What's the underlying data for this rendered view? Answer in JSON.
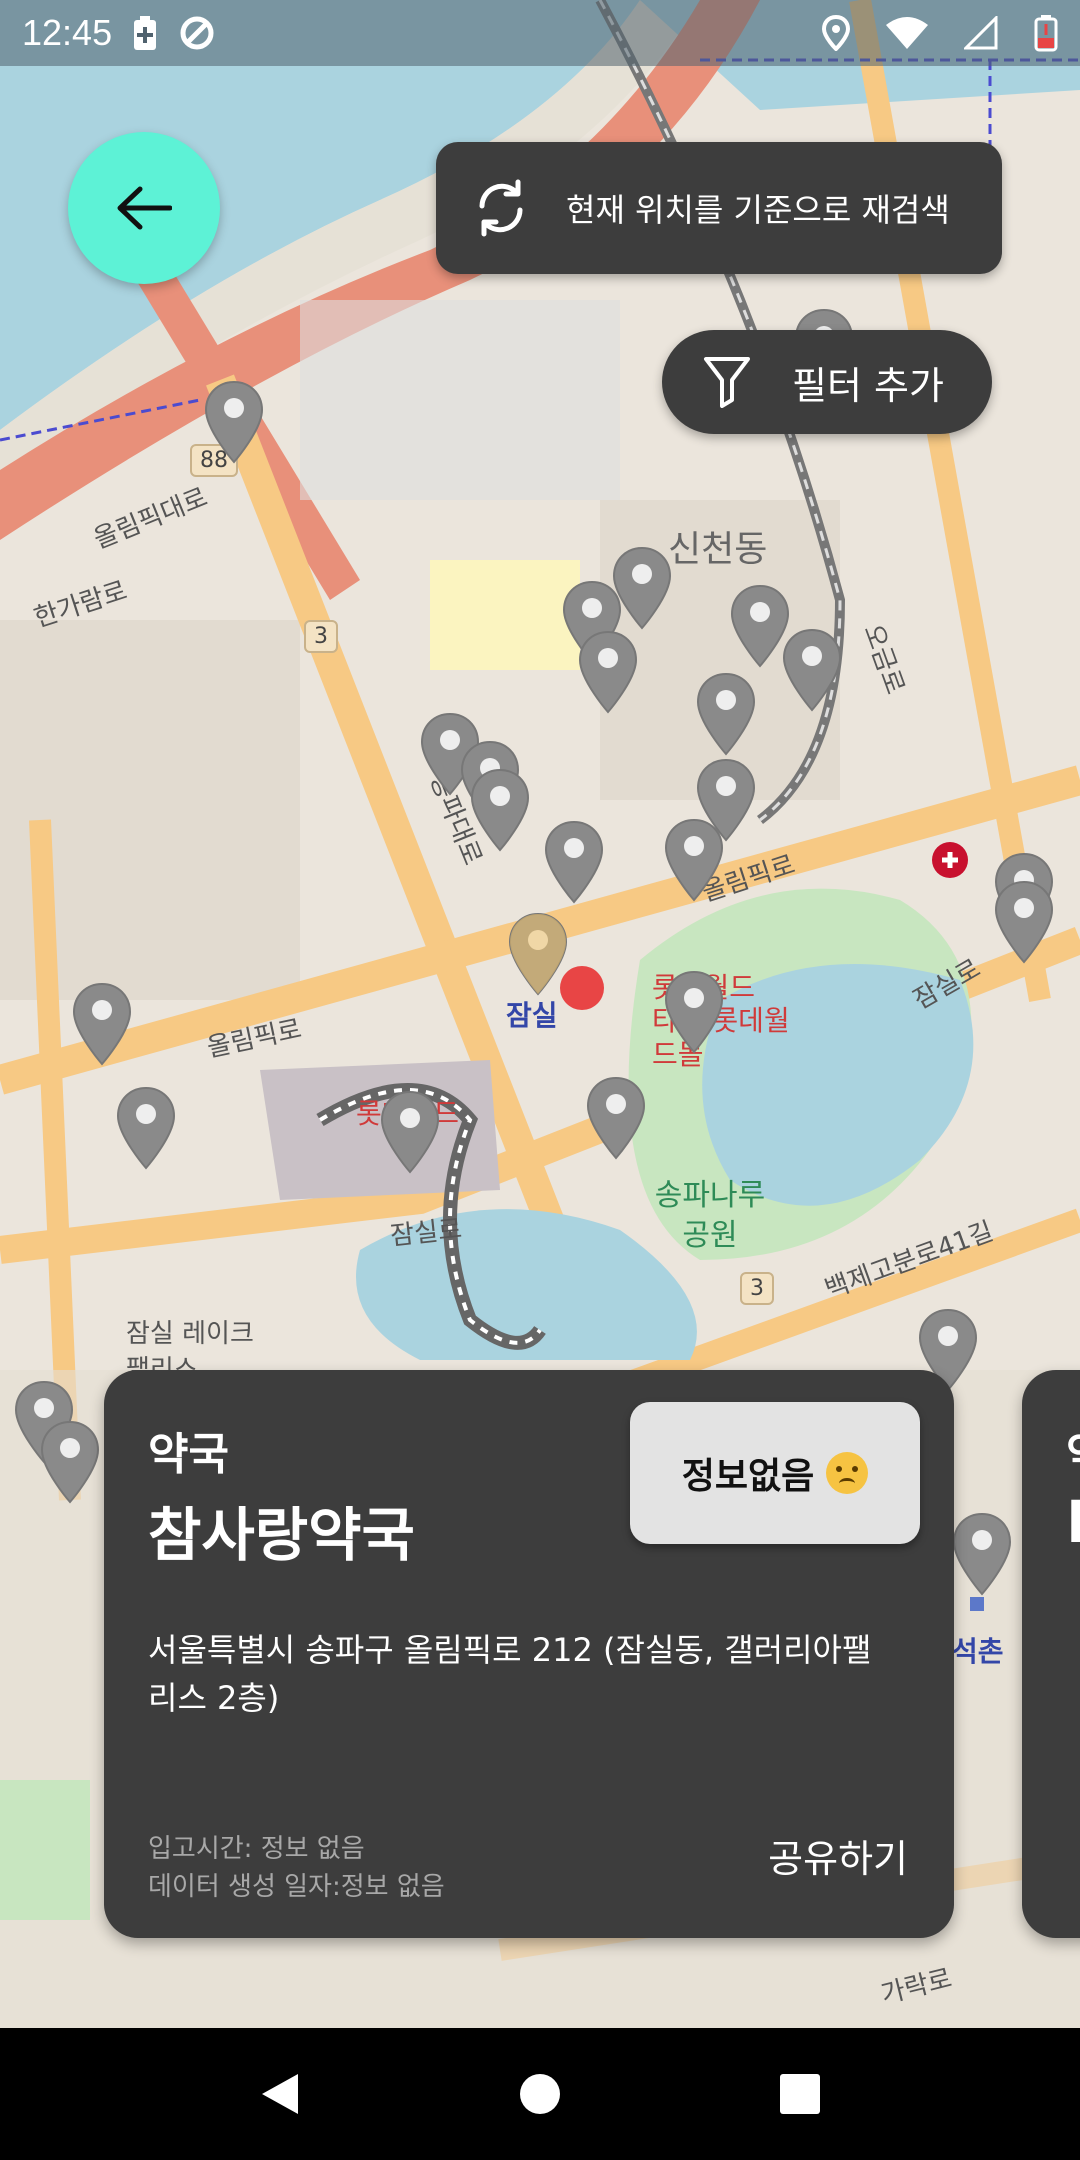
{
  "status_bar": {
    "time": "12:45",
    "icons_left": [
      "battery-saver-icon",
      "data-saver-icon"
    ],
    "icons_right": [
      "location-icon",
      "wifi-icon",
      "signal-icon",
      "battery-icon"
    ]
  },
  "back_button": {
    "icon": "arrow-left-icon"
  },
  "rescan": {
    "icon": "refresh-icon",
    "label": "현재 위치를 기준으로 재검색"
  },
  "filter": {
    "icon": "filter-icon",
    "label": "필터 추가"
  },
  "map": {
    "labels": {
      "olympic_daero": "올림픽대로",
      "singido_ro": "한가람로",
      "sincheon_dong": "신천동",
      "jamsil": "잠실",
      "lotte_world": "롯데월드",
      "lotte_mall": "타워 롯데월드몰",
      "olympic_ro_1": "올림픽로",
      "olympic_ro_2": "올림픽로",
      "songpa_daero": "송파대로",
      "jamsil_ro": "잠실로",
      "ogeum_ro": "오금로",
      "jamsil_ro_2": "잠실로",
      "songpa_naru_park": "송파나루 공원",
      "baekjegobun_ro": "백제고분로41길",
      "seokchon": "석촌",
      "garak_ro": "가락로",
      "lotte_world_2": "롯데월드",
      "jamsil_lake": "잠실 레이크팰리스"
    },
    "shields": {
      "shield_88": "88",
      "shield_3a": "3",
      "shield_3b": "3"
    }
  },
  "cards": [
    {
      "category": "약국",
      "name": "참사랑약국",
      "address": "서울특별시 송파구 올림픽로 212 (잠실동, 갤러리아팰리스 2층)",
      "stock_status": "정보없음",
      "stock_emoji": "crying-face-icon",
      "arrival_time": "입고시간: 정보 없음",
      "data_created": "데이터 생성 일자:정보 없음",
      "share_label": "공유하기"
    },
    {
      "category": "약",
      "name": "D"
    }
  ],
  "nav_bar": {
    "back": "back-icon",
    "home": "home-icon",
    "recents": "recents-icon"
  },
  "colors": {
    "accent": "#5df2d6",
    "card_bg": "#3d3d3d",
    "badge_bg": "#e3e3e3"
  }
}
